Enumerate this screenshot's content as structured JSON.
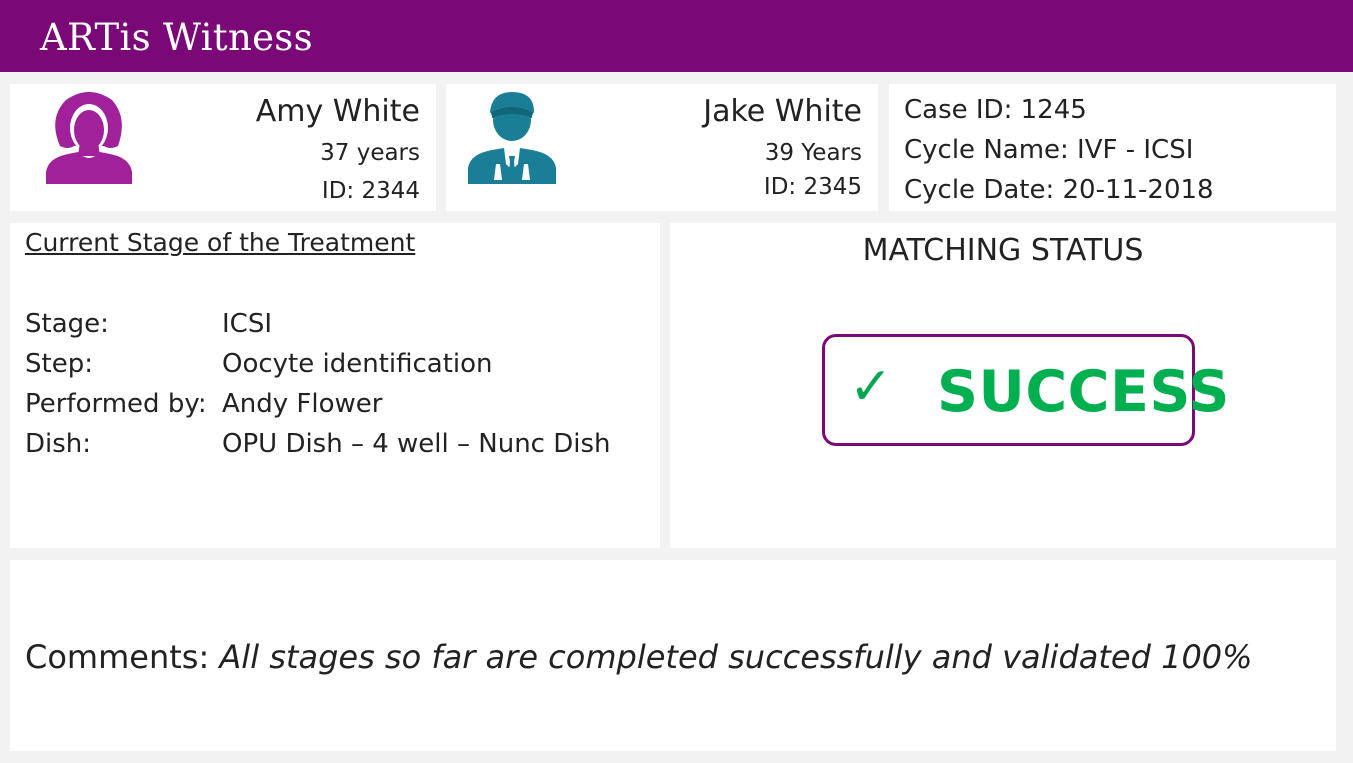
{
  "app": {
    "title": "ARTis Witness"
  },
  "female_patient": {
    "name": "Amy White",
    "age": "37 years",
    "id": "ID: 2344",
    "icon": "female-user-icon"
  },
  "male_patient": {
    "name": "Jake White",
    "age": "39 Years",
    "id": "ID: 2345",
    "icon": "male-user-icon"
  },
  "case": {
    "case_id": "Case ID: 1245",
    "cycle_name": "Cycle Name: IVF - ICSI",
    "cycle_date": "Cycle Date: 20-11-2018"
  },
  "treatment": {
    "heading": "Current Stage of the Treatment",
    "rows": [
      {
        "label": "Stage:",
        "value": "ICSI"
      },
      {
        "label": "Step:",
        "value": "Oocyte identification"
      },
      {
        "label": "Performed by:",
        "value": "Andy Flower"
      },
      {
        "label": "Dish:",
        "value": "OPU Dish – 4 well – Nunc Dish"
      }
    ]
  },
  "matching": {
    "heading": "MATCHING STATUS",
    "check": "✓",
    "status": "SUCCESS"
  },
  "comments": {
    "label": "Comments:",
    "text": "All stages so far are completed successfully and validated 100%"
  },
  "colors": {
    "brand": "#7a0877",
    "success": "#00b050",
    "female_icon": "#a0219a",
    "male_icon": "#1a7f96"
  }
}
